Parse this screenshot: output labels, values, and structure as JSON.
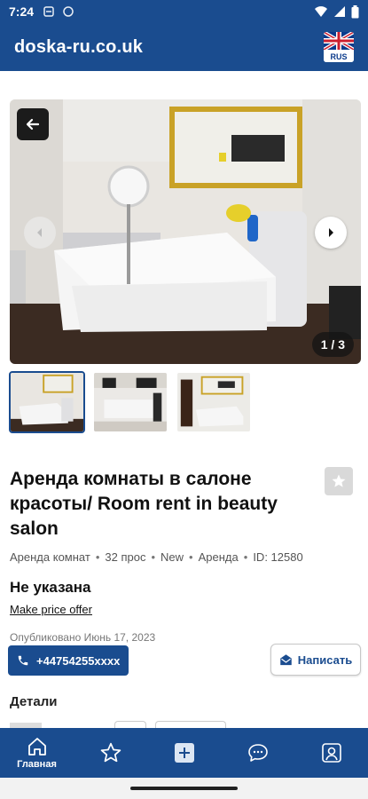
{
  "status_bar": {
    "time": "7:24"
  },
  "app_bar": {
    "title": "doska-ru.co.uk",
    "language_badge": "RUS"
  },
  "gallery": {
    "counter": "1 / 3",
    "current_index": 1,
    "total": 3,
    "thumbnails": [
      "thumb-1",
      "thumb-2",
      "thumb-3"
    ]
  },
  "listing": {
    "title": "Аренда комнаты в салоне красоты/ Room rent in beauty salon",
    "meta": [
      "Аренда комнат",
      "32 прос",
      "New",
      "Аренда",
      "ID: 12580"
    ],
    "price": "Не указана",
    "price_offer_link": "Make price offer",
    "published": "Опубликовано Июнь 17, 2023",
    "phone": "+44754255xxxx",
    "write_button": "Написать"
  },
  "details": {
    "heading": "Детали"
  },
  "bottom_nav": {
    "items": [
      {
        "label": "Главная",
        "icon": "home-icon",
        "active": true
      },
      {
        "label": "",
        "icon": "star-icon",
        "active": false
      },
      {
        "label": "",
        "icon": "plus-square-icon",
        "active": false
      },
      {
        "label": "",
        "icon": "chat-icon",
        "active": false
      },
      {
        "label": "",
        "icon": "profile-icon",
        "active": false
      }
    ]
  },
  "colors": {
    "primary": "#1a4c8f",
    "fav_bg": "#d9d9d9"
  }
}
